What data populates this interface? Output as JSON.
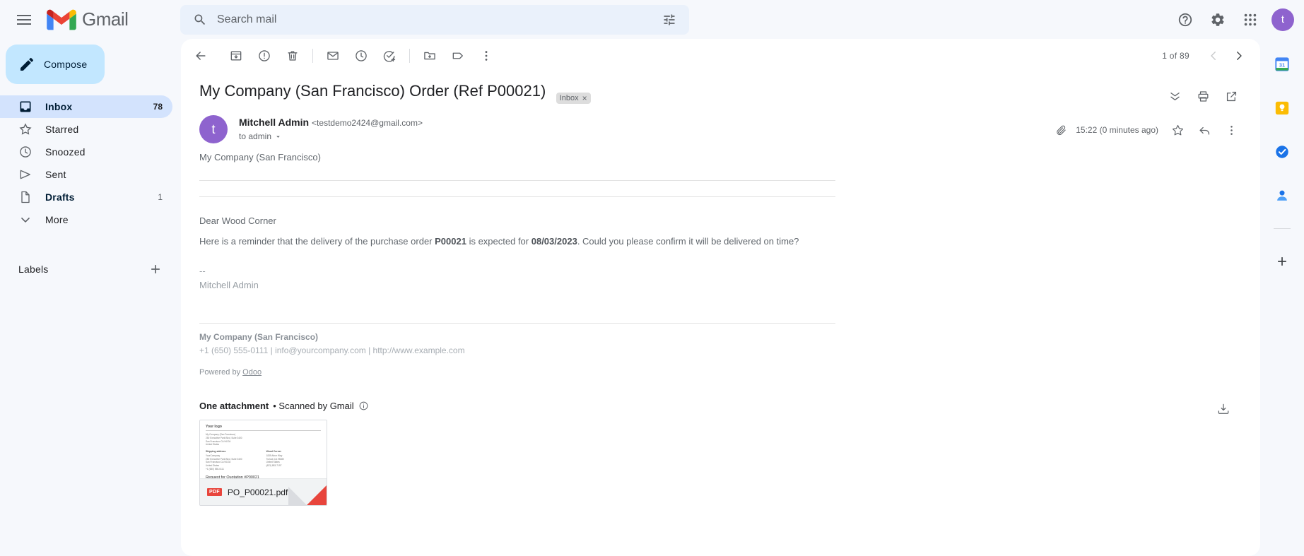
{
  "app": {
    "brand": "Gmail",
    "avatar_initial": "t"
  },
  "search": {
    "placeholder": "Search mail",
    "value": ""
  },
  "topbar": {
    "menu_label": "Main menu",
    "support_label": "Support",
    "settings_label": "Settings",
    "apps_label": "Google apps",
    "account_label": "Google Account"
  },
  "sidebar": {
    "compose_label": "Compose",
    "items": [
      {
        "label": "Inbox",
        "count": "78",
        "icon": "inbox-icon",
        "active": true,
        "bold": false
      },
      {
        "label": "Starred",
        "count": "",
        "icon": "star-icon",
        "active": false,
        "bold": false
      },
      {
        "label": "Snoozed",
        "count": "",
        "icon": "clock-icon",
        "active": false,
        "bold": false
      },
      {
        "label": "Sent",
        "count": "",
        "icon": "send-icon",
        "active": false,
        "bold": false
      },
      {
        "label": "Drafts",
        "count": "1",
        "icon": "draft-icon",
        "active": false,
        "bold": true
      },
      {
        "label": "More",
        "count": "",
        "icon": "chevron-down-icon",
        "active": false,
        "bold": false
      }
    ],
    "labels_title": "Labels",
    "labels_add_label": "Create new label"
  },
  "toolbar": {
    "back_label": "Back to Inbox",
    "archive_label": "Archive",
    "spam_label": "Report spam",
    "delete_label": "Delete",
    "unread_label": "Mark as unread",
    "snooze_label": "Snooze",
    "task_label": "Add to tasks",
    "move_label": "Move to",
    "labels_label": "Labels",
    "more_label": "More",
    "pagination": "1 of 89",
    "prev_label": "Newer",
    "next_label": "Older"
  },
  "email": {
    "subject": "My Company (San Francisco) Order (Ref P00021)",
    "label_chip": "Inbox",
    "label_chip_remove": "×",
    "collapse_label": "Collapse all",
    "print_label": "Print all",
    "popout_label": "Open in new window",
    "sender_initial": "t",
    "sender_name": "Mitchell Admin",
    "sender_email": "<testdemo2424@gmail.com>",
    "recipient": "to admin",
    "attachment_indicator": "attachment-icon",
    "time": "15:22 (0 minutes ago)",
    "star_label": "Star",
    "reply_label": "Reply",
    "more_label": "More"
  },
  "body": {
    "company": "My Company (San Francisco)",
    "greeting": "Dear Wood Corner",
    "paragraph_pre": "Here is a reminder that the delivery of the purchase order ",
    "order_ref": "P00021",
    "paragraph_mid": " is expected for ",
    "expected_date": "08/03/2023",
    "paragraph_post": ". Could you please confirm it will be delivered on time?",
    "sig_dashes": "--",
    "sig_name": "Mitchell Admin",
    "footer_company": "My Company (San Francisco)",
    "footer_contact": "+1 (650) 555-0111 | info@yourcompany.com | http://www.example.com",
    "powered_prefix": "Powered by ",
    "powered_link": "Odoo"
  },
  "attachment": {
    "header_title": "One attachment",
    "header_sub": "• Scanned by Gmail",
    "info_label": "More info",
    "download_label": "Download all attachments",
    "file_type": "PDF",
    "file_name": "PO_P00021.pdf",
    "preview": {
      "logo": "Your logo",
      "addr_lines": [
        "My Company (San Francisco)",
        "250 Executive Park Blvd, Suite 3400",
        "San Francisco CA 94134",
        "United States"
      ],
      "ship_title": "Shipping address",
      "ship_lines": [
        "YourCompany",
        "250 Executive Park Blvd, Suite 3400",
        "San Francisco CA 94134",
        "United States",
        "+1 (650) 555-0111"
      ],
      "vendor_title": "Wood Corner",
      "vendor_lines": [
        "1839 Arbor Way",
        "Turlock CA 95380",
        "United States",
        "(623) 853-7197"
      ],
      "doc_title": "Request for Quotation #P00021"
    }
  },
  "rightrail": {
    "items": [
      {
        "name": "google-calendar-icon",
        "label": "Calendar"
      },
      {
        "name": "google-keep-icon",
        "label": "Keep"
      },
      {
        "name": "google-tasks-icon",
        "label": "Tasks"
      },
      {
        "name": "google-contacts-icon",
        "label": "Contacts"
      }
    ],
    "add_label": "Get add-ons"
  },
  "colors": {
    "accent": "#c2e7ff",
    "active_nav": "#d3e3fd",
    "avatar": "#8e63ce",
    "pdf_red": "#e8453c",
    "page_bg": "#f6f8fc"
  }
}
